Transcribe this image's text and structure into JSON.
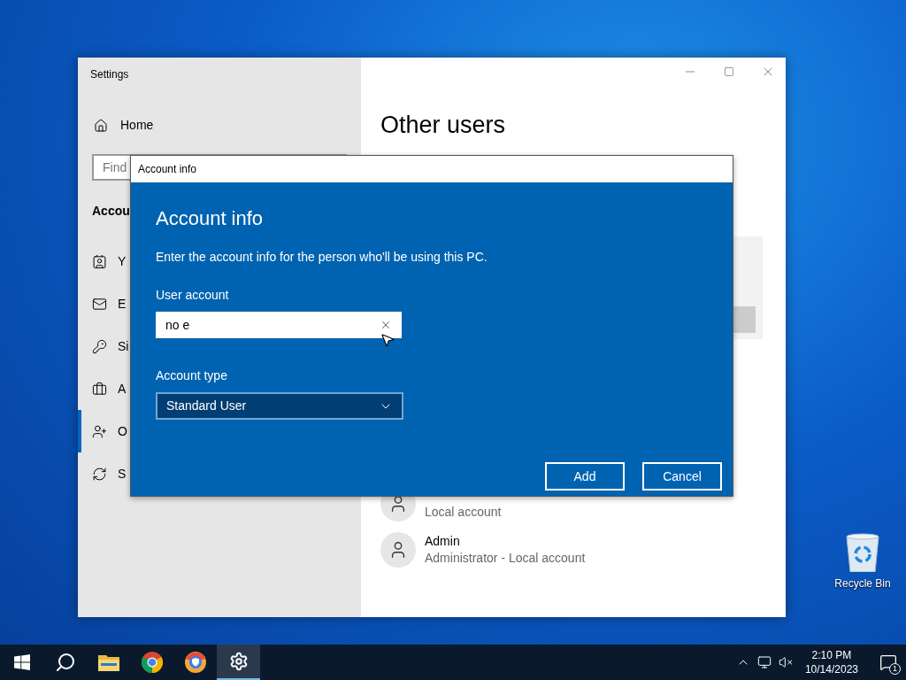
{
  "settings_window": {
    "title": "Settings",
    "home": "Home",
    "search": {
      "placeholder": "Find"
    },
    "section": "Accou",
    "nav_items": [
      {
        "label": "Y",
        "selected": false
      },
      {
        "label": "E",
        "selected": false
      },
      {
        "label": "Si",
        "selected": false
      },
      {
        "label": "A",
        "selected": false
      },
      {
        "label": "O",
        "selected": true
      },
      {
        "label": "S",
        "selected": false
      }
    ],
    "heading": "Other users",
    "users": [
      {
        "subtitle": "Local account"
      },
      {
        "name": "Admin",
        "subtitle": "Administrator - Local account"
      }
    ]
  },
  "dialog": {
    "title": "Account info",
    "heading": "Account info",
    "instructions": "Enter the account info for the person who'll be using this PC.",
    "user_account": {
      "label": "User account",
      "value": "no e"
    },
    "account_type": {
      "label": "Account type",
      "value": "Standard User"
    },
    "buttons": [
      "Add",
      "Cancel"
    ]
  },
  "desktop_icons": [
    {
      "label": "Recycle Bin"
    }
  ],
  "taskbar": {
    "apps": [
      {
        "kind": "start",
        "selected": false
      },
      {
        "kind": "search",
        "selected": false
      },
      {
        "kind": "folder",
        "selected": false
      },
      {
        "kind": "chrome",
        "selected": false
      },
      {
        "kind": "shield-browser",
        "selected": false
      },
      {
        "kind": "settings",
        "selected": true
      }
    ],
    "clock": {
      "time": "2:10 PM",
      "date": "10/14/2023"
    },
    "notifications": "1"
  }
}
